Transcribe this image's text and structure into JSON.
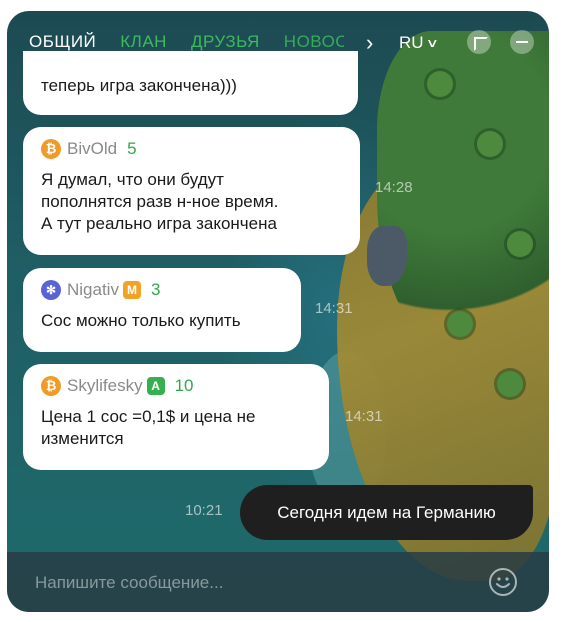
{
  "tabs": [
    {
      "label": "ОБЩИЙ",
      "active": true
    },
    {
      "label": "КЛАН",
      "active": false
    },
    {
      "label": "ДРУЗЬЯ",
      "active": false
    },
    {
      "label": "НОВОСТИ",
      "active": false
    }
  ],
  "language": "RU",
  "icons": {
    "tabs_next": "chevron-right-icon",
    "language_toggle": "chevron-down-icon",
    "expand": "expand-icon",
    "minimize": "minimize-icon",
    "emoji": "smiley-icon"
  },
  "colors": {
    "accent_green": "#2fb64f",
    "bubble_bg": "#ffffff",
    "own_bubble_bg": "#1f1f1f"
  },
  "messages": [
    {
      "text": "теперь игра закончена)))"
    },
    {
      "user": "BivOld",
      "coin": "bitcoin",
      "level": "5",
      "text": "Я думал, что они будут\nпополнятся разв н-ное время.\nА тут реально игра закончена",
      "time": "14:28"
    },
    {
      "user": "Nigativ",
      "coin": "cosmos",
      "badge": "M",
      "level": "3",
      "text": "Сос можно только купить",
      "time": "14:31"
    },
    {
      "user": "Skylifesky",
      "coin": "bitcoin",
      "badge": "A",
      "level": "10",
      "text": "Цена 1 сос =0,1$ и цена не\nизменится",
      "time": "14:31"
    }
  ],
  "own_message": {
    "text": "Сегодня идем на Германию",
    "time": "10:21"
  },
  "input": {
    "placeholder": "Напишите сообщение...",
    "value": ""
  }
}
